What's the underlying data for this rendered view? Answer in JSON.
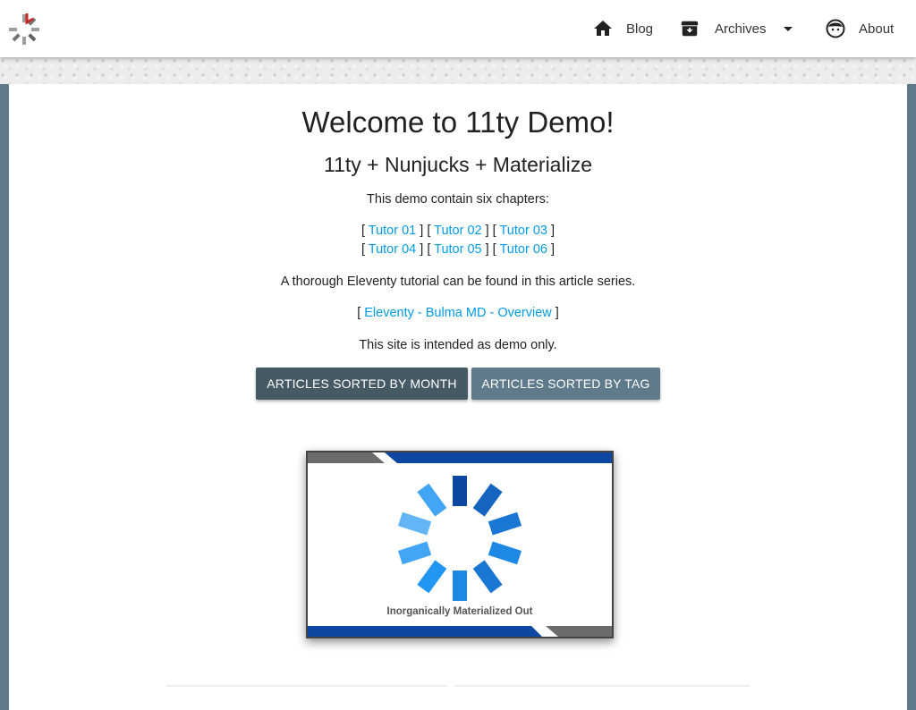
{
  "nav": {
    "blog": "Blog",
    "archives": "Archives",
    "about": "About"
  },
  "main": {
    "title": "Welcome to 11ty Demo!",
    "subtitle": "11ty + Nunjucks + Materialize",
    "intro": "This demo contain six chapters:",
    "tutors": [
      "Tutor 01",
      "Tutor 02",
      "Tutor 03",
      "Tutor 04",
      "Tutor 05",
      "Tutor 06"
    ],
    "series_text": "A thorough Eleventy tutorial can be found in this article series.",
    "series_link": "Eleventy - Bulma MD - Overview",
    "demo_note": "This site is intended as demo only.",
    "buttons": {
      "by_month": "ARTICLES SORTED BY MONTH",
      "by_tag": "ARTICLES SORTED BY TAG"
    },
    "banner_caption": "Inorganically Materialized Out"
  },
  "colors": {
    "navbar": "#ffffff",
    "page_background": "#5f7a8a",
    "link": "#039be5",
    "button_month": "#455a64",
    "button_tag": "#5f7a8a",
    "banner_blue": "#0d47a1"
  }
}
